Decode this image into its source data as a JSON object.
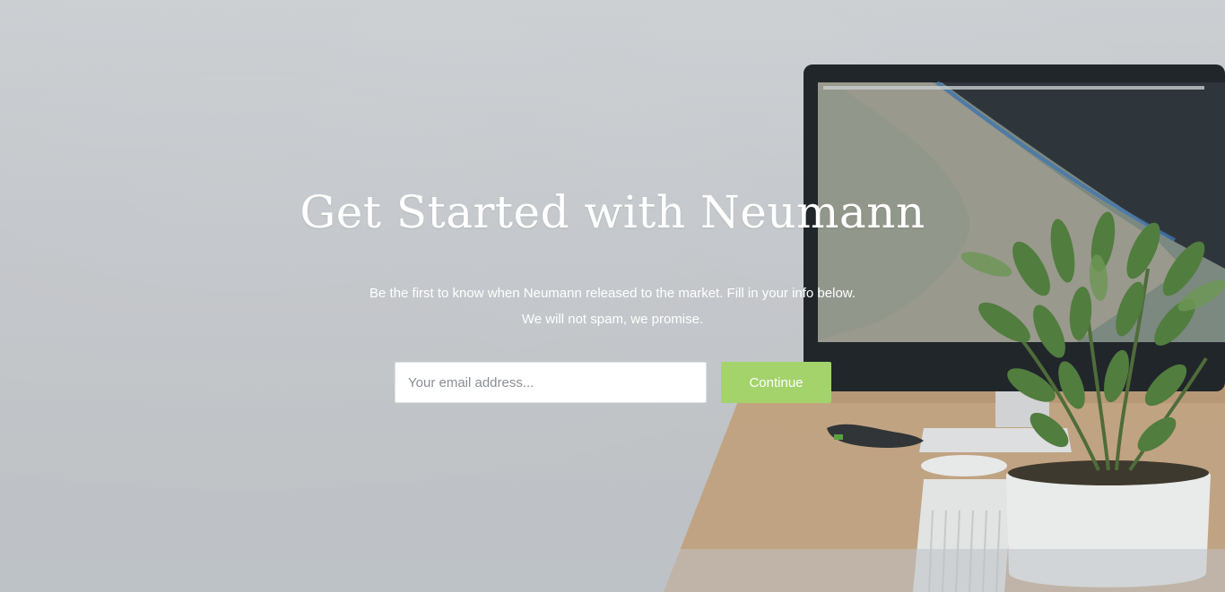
{
  "hero": {
    "title": "Get Started with Neumann",
    "subtitle_line1": "Be the first to know when Neumann released to the market. Fill in your info below.",
    "subtitle_line2": "We will not spam, we promise."
  },
  "signup": {
    "email_placeholder": "Your email address...",
    "email_value": "",
    "continue_label": "Continue"
  },
  "colors": {
    "accent": "#a3d36a",
    "text": "#ffffff",
    "background": "#c9ccd0"
  },
  "icons": {
    "background_image": "desk-workspace-photo"
  }
}
